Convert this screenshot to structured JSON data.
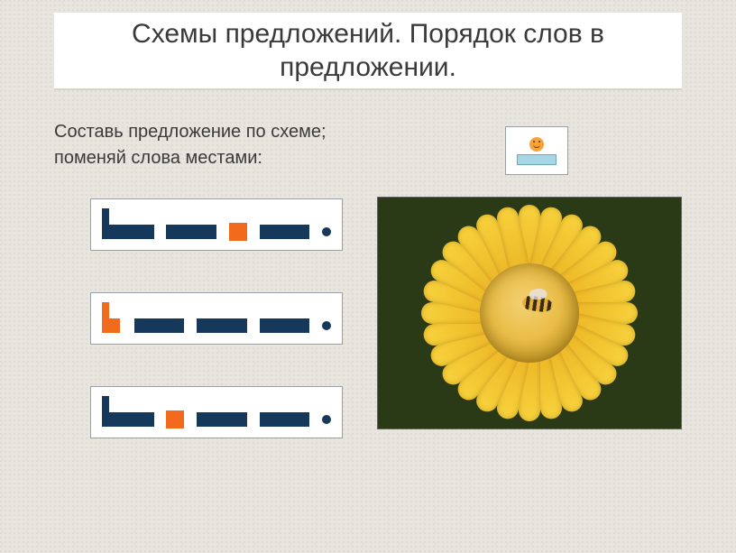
{
  "title": "Схемы предложений. Порядок слов в предложении.",
  "instruction_line1": "Составь предложение по схеме;",
  "instruction_line2": "поменяй слова местами:",
  "period": ".",
  "colors": {
    "word": "#16385a",
    "preposition": "#f26b1d",
    "panel": "#ffffff"
  },
  "schemes": [
    {
      "blocks": [
        "CapWord",
        "Word",
        "Prep",
        "Word",
        "Period"
      ]
    },
    {
      "blocks": [
        "CapPrep",
        "Word",
        "Word",
        "Word",
        "Period"
      ]
    },
    {
      "blocks": [
        "CapWord",
        "Prep",
        "Word",
        "Word",
        "Period"
      ]
    }
  ],
  "image": {
    "description": "bee on yellow flower",
    "petal_count": 28
  }
}
